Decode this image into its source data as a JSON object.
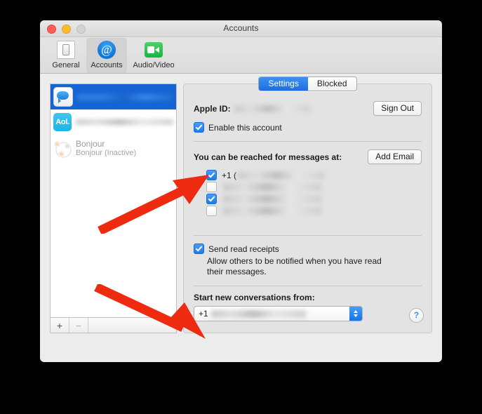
{
  "window": {
    "title": "Accounts",
    "traffic_lights": [
      "close-red",
      "minimize-yellow",
      "zoom-disabled-gray"
    ]
  },
  "toolbar": {
    "items": [
      {
        "label": "General",
        "icon": "general-switch-icon",
        "selected": false
      },
      {
        "label": "Accounts",
        "icon": "at-sign-icon",
        "selected": true
      },
      {
        "label": "Audio/Video",
        "icon": "video-camera-icon",
        "selected": false
      }
    ]
  },
  "accounts_list": {
    "items": [
      {
        "name": "",
        "icon": "messages-icon",
        "selected": true,
        "redacted": true
      },
      {
        "name": "",
        "icon": "aol-icon",
        "icon_label": "Aol.",
        "selected": false,
        "redacted": true
      },
      {
        "name": "Bonjour",
        "subtitle": "Bonjour (Inactive)",
        "icon": "bonjour-icon",
        "selected": false,
        "redacted": false
      }
    ],
    "add_button": "+",
    "remove_button": "−"
  },
  "panel": {
    "tabs": [
      {
        "label": "Settings",
        "active": true
      },
      {
        "label": "Blocked",
        "active": false
      }
    ],
    "apple_id": {
      "label": "Apple ID:",
      "value": "",
      "redacted": true,
      "sign_out_label": "Sign Out"
    },
    "enable_account": {
      "label": "Enable this account",
      "checked": true
    },
    "reachable": {
      "heading": "You can be reached for messages at:",
      "add_email_label": "Add Email",
      "rows": [
        {
          "checked": true,
          "prefix": "+1 (",
          "redacted": true
        },
        {
          "checked": false,
          "prefix": "",
          "redacted": true
        },
        {
          "checked": true,
          "prefix": "",
          "redacted": true
        },
        {
          "checked": false,
          "prefix": "",
          "redacted": true
        }
      ]
    },
    "read_receipts": {
      "label": "Send read receipts",
      "checked": true,
      "description_line1": "Allow others to be notified when you have read",
      "description_line2": "their messages."
    },
    "start_from": {
      "label": "Start new conversations from:",
      "selected_value": "+1",
      "redacted": true
    },
    "help_button": "?"
  },
  "annotations": {
    "arrows": [
      {
        "name": "arrow-to-first-reachable-checkbox",
        "color": "#ee2b11"
      },
      {
        "name": "arrow-to-start-from-popup",
        "color": "#ee2b11"
      }
    ]
  },
  "colors": {
    "accent_blue": "#1a7ceb",
    "selection_blue": "#1464d3",
    "annotation_red": "#ee2b11",
    "window_bg": "#ececec",
    "panel_bg": "#e3e3e3"
  }
}
